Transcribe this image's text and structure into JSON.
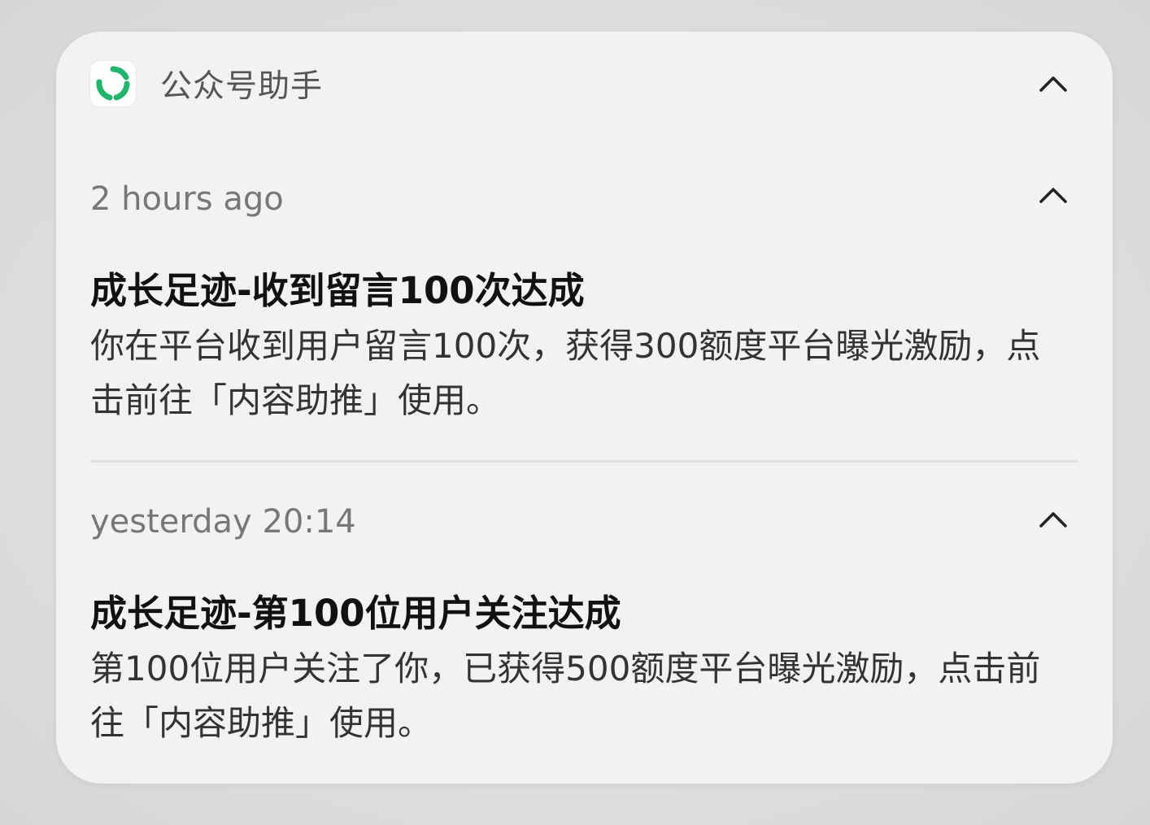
{
  "app": {
    "name": "公众号助手",
    "icon": "wechat-official-account-icon",
    "accent": "#1fb56b"
  },
  "notifications": [
    {
      "time": "2 hours ago",
      "title": "成长足迹-收到留言100次达成",
      "body": "你在平台收到用户留言100次，获得300额度平台曝光激励，点击前往「内容助推」使用。"
    },
    {
      "time": "yesterday 20:14",
      "title": "成长足迹-第100位用户关注达成",
      "body": "第100位用户关注了你，已获得500额度平台曝光激励，点击前往「内容助推」使用。"
    }
  ],
  "icons": {
    "collapse": "chevron-up-icon"
  }
}
